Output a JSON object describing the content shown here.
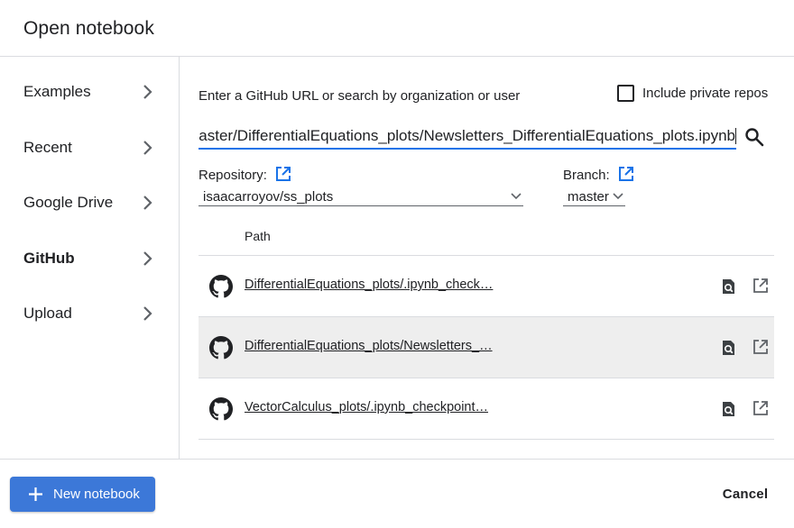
{
  "dialog": {
    "title": "Open notebook"
  },
  "sidebar": {
    "items": [
      {
        "label": "Examples",
        "active": false
      },
      {
        "label": "Recent",
        "active": false
      },
      {
        "label": "Google Drive",
        "active": false
      },
      {
        "label": "GitHub",
        "active": true
      },
      {
        "label": "Upload",
        "active": false
      }
    ]
  },
  "github": {
    "prompt": "Enter a GitHub URL or search by organization or user",
    "include_private_label": "Include private repos",
    "include_private_checked": false,
    "url_value": "aster/DifferentialEquations_plots/Newsletters_DifferentialEquations_plots.ipynb",
    "repository_label": "Repository:",
    "repository_value": "isaacarroyov/ss_plots",
    "branch_label": "Branch:",
    "branch_value": "master",
    "path_header": "Path",
    "rows": [
      {
        "path": "DifferentialEquations_plots/.ipynb_check…",
        "highlighted": false
      },
      {
        "path": "DifferentialEquations_plots/Newsletters_…",
        "highlighted": true
      },
      {
        "path": "VectorCalculus_plots/.ipynb_checkpoint…",
        "highlighted": false
      }
    ]
  },
  "footer": {
    "new_notebook_label": "New notebook",
    "cancel_label": "Cancel"
  },
  "colors": {
    "accent": "#1a73e8",
    "primary_button": "#3c78d8",
    "row_highlight": "#eeeeee",
    "divider": "#dadce0"
  }
}
